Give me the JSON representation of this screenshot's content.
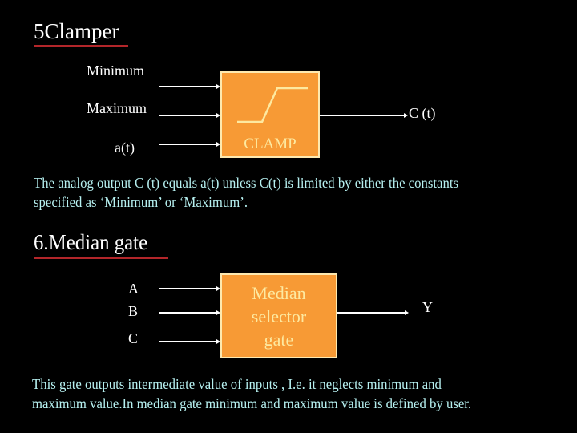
{
  "clamper": {
    "title": "5Clamper",
    "inputs": [
      "Minimum",
      "Maximum",
      "a(t)"
    ],
    "block_label": "CLAMP",
    "output": "C (t)",
    "description_line1": "The analog output  C (t) equals  a(t) unless  C(t) is limited  by either the constants",
    "description_line2": "specified as ‘Minimum’ or ‘Maximum’."
  },
  "median": {
    "title": "6.Median gate",
    "inputs": [
      "A",
      "B",
      "C"
    ],
    "block_lines": [
      "Median",
      "selector",
      "gate"
    ],
    "output": "Y",
    "description_line1": "This gate outputs  intermediate  value of inputs , I.e. it neglects minimum  and",
    "description_line2": "maximum value.In median gate minimum and maximum value is defined by user."
  },
  "colors": {
    "background": "#000000",
    "block_fill": "#f79a35",
    "block_border": "#fde9b0",
    "underline": "#b3262a",
    "paragraph_text": "#b6f0f0"
  }
}
